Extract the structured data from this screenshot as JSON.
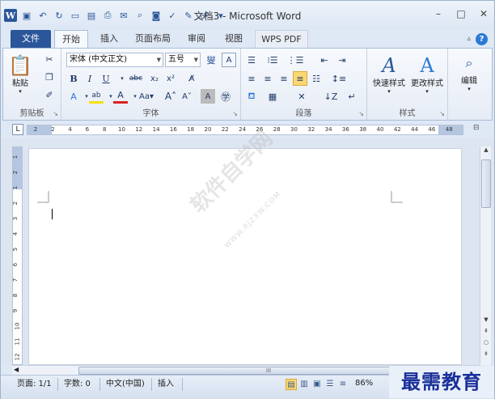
{
  "window": {
    "title": "文档3 - Microsoft Word"
  },
  "tabs": [
    {
      "label": "文件"
    },
    {
      "label": "开始"
    },
    {
      "label": "插入"
    },
    {
      "label": "页面布局"
    },
    {
      "label": "审阅"
    },
    {
      "label": "视图"
    },
    {
      "label": "WPS PDF"
    }
  ],
  "groups": {
    "clipboard": {
      "label": "剪贴板",
      "paste": "粘贴"
    },
    "font": {
      "label": "字体",
      "font_name": "宋体 (中文正文)",
      "font_size": "五号"
    },
    "paragraph": {
      "label": "段落"
    },
    "styles": {
      "label": "样式",
      "quick": "快速样式",
      "change": "更改样式"
    },
    "editing": {
      "label": "编辑"
    }
  },
  "ruler": {
    "ticks": [
      "2",
      "2",
      "4",
      "6",
      "8",
      "10",
      "12",
      "14",
      "16",
      "18",
      "20",
      "22",
      "24",
      "26",
      "28",
      "30",
      "32",
      "34",
      "36",
      "38",
      "40",
      "42",
      "44",
      "46",
      "48"
    ]
  },
  "vruler": {
    "ticks": [
      "1",
      "2",
      "1",
      "2",
      "3",
      "4",
      "5",
      "6",
      "7",
      "8",
      "9",
      "10",
      "11",
      "12"
    ]
  },
  "hscroll": {
    "grip": "III"
  },
  "statusbar": {
    "page": "页面: 1/1",
    "words": "字数: 0",
    "lang": "中文(中国)",
    "mode": "插入",
    "zoom": "86%"
  },
  "watermark": {
    "main": "软件自学网",
    "sub": "WWW.RJZXW.COM"
  },
  "brand": {
    "text": "最需教育"
  }
}
